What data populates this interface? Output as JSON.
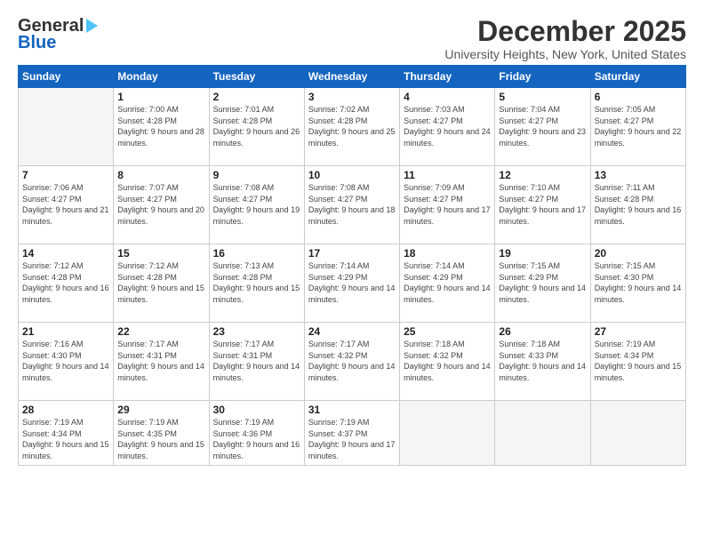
{
  "logo": {
    "line1": "General",
    "line2": "Blue"
  },
  "title": "December 2025",
  "subtitle": "University Heights, New York, United States",
  "days_of_week": [
    "Sunday",
    "Monday",
    "Tuesday",
    "Wednesday",
    "Thursday",
    "Friday",
    "Saturday"
  ],
  "weeks": [
    [
      {
        "day": "",
        "empty": true
      },
      {
        "day": "1",
        "sunrise": "7:00 AM",
        "sunset": "4:28 PM",
        "daylight": "9 hours and 28 minutes."
      },
      {
        "day": "2",
        "sunrise": "7:01 AM",
        "sunset": "4:28 PM",
        "daylight": "9 hours and 26 minutes."
      },
      {
        "day": "3",
        "sunrise": "7:02 AM",
        "sunset": "4:28 PM",
        "daylight": "9 hours and 25 minutes."
      },
      {
        "day": "4",
        "sunrise": "7:03 AM",
        "sunset": "4:27 PM",
        "daylight": "9 hours and 24 minutes."
      },
      {
        "day": "5",
        "sunrise": "7:04 AM",
        "sunset": "4:27 PM",
        "daylight": "9 hours and 23 minutes."
      },
      {
        "day": "6",
        "sunrise": "7:05 AM",
        "sunset": "4:27 PM",
        "daylight": "9 hours and 22 minutes."
      }
    ],
    [
      {
        "day": "7",
        "sunrise": "7:06 AM",
        "sunset": "4:27 PM",
        "daylight": "9 hours and 21 minutes."
      },
      {
        "day": "8",
        "sunrise": "7:07 AM",
        "sunset": "4:27 PM",
        "daylight": "9 hours and 20 minutes."
      },
      {
        "day": "9",
        "sunrise": "7:08 AM",
        "sunset": "4:27 PM",
        "daylight": "9 hours and 19 minutes."
      },
      {
        "day": "10",
        "sunrise": "7:08 AM",
        "sunset": "4:27 PM",
        "daylight": "9 hours and 18 minutes."
      },
      {
        "day": "11",
        "sunrise": "7:09 AM",
        "sunset": "4:27 PM",
        "daylight": "9 hours and 17 minutes."
      },
      {
        "day": "12",
        "sunrise": "7:10 AM",
        "sunset": "4:27 PM",
        "daylight": "9 hours and 17 minutes."
      },
      {
        "day": "13",
        "sunrise": "7:11 AM",
        "sunset": "4:28 PM",
        "daylight": "9 hours and 16 minutes."
      }
    ],
    [
      {
        "day": "14",
        "sunrise": "7:12 AM",
        "sunset": "4:28 PM",
        "daylight": "9 hours and 16 minutes."
      },
      {
        "day": "15",
        "sunrise": "7:12 AM",
        "sunset": "4:28 PM",
        "daylight": "9 hours and 15 minutes."
      },
      {
        "day": "16",
        "sunrise": "7:13 AM",
        "sunset": "4:28 PM",
        "daylight": "9 hours and 15 minutes."
      },
      {
        "day": "17",
        "sunrise": "7:14 AM",
        "sunset": "4:29 PM",
        "daylight": "9 hours and 14 minutes."
      },
      {
        "day": "18",
        "sunrise": "7:14 AM",
        "sunset": "4:29 PM",
        "daylight": "9 hours and 14 minutes."
      },
      {
        "day": "19",
        "sunrise": "7:15 AM",
        "sunset": "4:29 PM",
        "daylight": "9 hours and 14 minutes."
      },
      {
        "day": "20",
        "sunrise": "7:15 AM",
        "sunset": "4:30 PM",
        "daylight": "9 hours and 14 minutes."
      }
    ],
    [
      {
        "day": "21",
        "sunrise": "7:16 AM",
        "sunset": "4:30 PM",
        "daylight": "9 hours and 14 minutes."
      },
      {
        "day": "22",
        "sunrise": "7:17 AM",
        "sunset": "4:31 PM",
        "daylight": "9 hours and 14 minutes."
      },
      {
        "day": "23",
        "sunrise": "7:17 AM",
        "sunset": "4:31 PM",
        "daylight": "9 hours and 14 minutes."
      },
      {
        "day": "24",
        "sunrise": "7:17 AM",
        "sunset": "4:32 PM",
        "daylight": "9 hours and 14 minutes."
      },
      {
        "day": "25",
        "sunrise": "7:18 AM",
        "sunset": "4:32 PM",
        "daylight": "9 hours and 14 minutes."
      },
      {
        "day": "26",
        "sunrise": "7:18 AM",
        "sunset": "4:33 PM",
        "daylight": "9 hours and 14 minutes."
      },
      {
        "day": "27",
        "sunrise": "7:19 AM",
        "sunset": "4:34 PM",
        "daylight": "9 hours and 15 minutes."
      }
    ],
    [
      {
        "day": "28",
        "sunrise": "7:19 AM",
        "sunset": "4:34 PM",
        "daylight": "9 hours and 15 minutes."
      },
      {
        "day": "29",
        "sunrise": "7:19 AM",
        "sunset": "4:35 PM",
        "daylight": "9 hours and 15 minutes."
      },
      {
        "day": "30",
        "sunrise": "7:19 AM",
        "sunset": "4:36 PM",
        "daylight": "9 hours and 16 minutes."
      },
      {
        "day": "31",
        "sunrise": "7:19 AM",
        "sunset": "4:37 PM",
        "daylight": "9 hours and 17 minutes."
      },
      {
        "day": "",
        "empty": true
      },
      {
        "day": "",
        "empty": true
      },
      {
        "day": "",
        "empty": true
      }
    ]
  ]
}
